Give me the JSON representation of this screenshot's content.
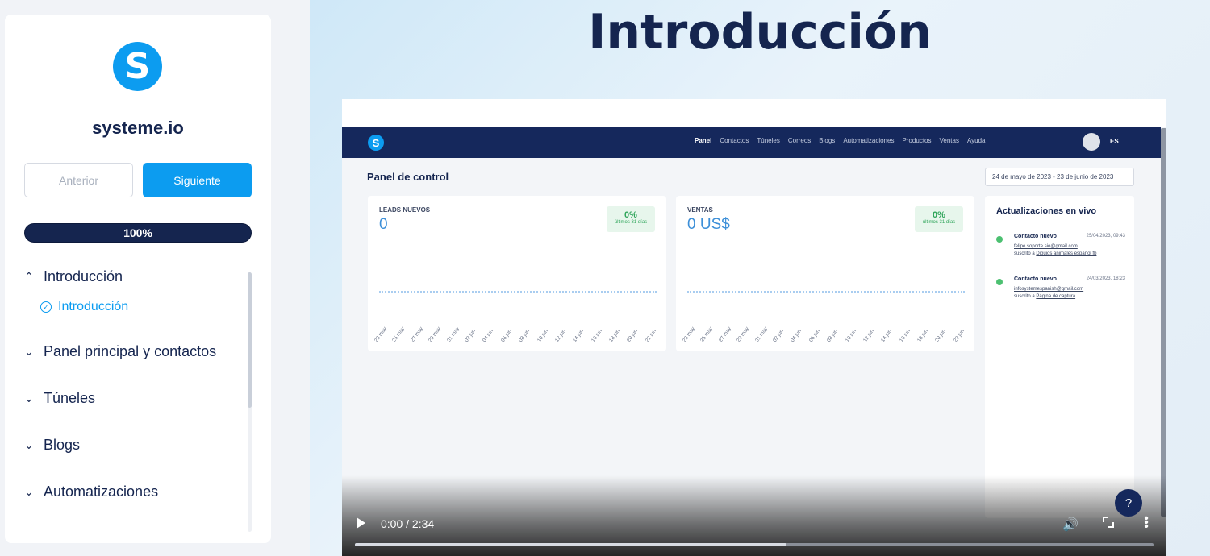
{
  "sidebar": {
    "logo_letter": "S",
    "brand": "systeme.io",
    "prev_label": "Anterior",
    "next_label": "Siguiente",
    "progress_label": "100%",
    "progress_value": 100,
    "sections": [
      {
        "label": "Introducción",
        "expanded": true,
        "lessons": [
          {
            "label": "Introducción",
            "completed": true
          }
        ]
      },
      {
        "label": "Panel principal y contactos",
        "expanded": false
      },
      {
        "label": "Túneles",
        "expanded": false
      },
      {
        "label": "Blogs",
        "expanded": false
      },
      {
        "label": "Automatizaciones",
        "expanded": false
      }
    ]
  },
  "main": {
    "title": "Introducción"
  },
  "video": {
    "logo_letter": "S",
    "menu": [
      "Panel",
      "Contactos",
      "Túneles",
      "Correos",
      "Blogs",
      "Automatizaciones",
      "Productos",
      "Ventas",
      "Ayuda"
    ],
    "lang": "ES",
    "panel_title": "Panel de control",
    "date_range": "24 de mayo de 2023 - 23 de junio de 2023",
    "cards": [
      {
        "label": "LEADS NUEVOS",
        "value": "0",
        "pct": "0%",
        "pct_sub": "últimos 31 días"
      },
      {
        "label": "VENTAS",
        "value": "0 US$",
        "pct": "0%",
        "pct_sub": "últimos 31 días"
      }
    ],
    "ticks": [
      "23 may",
      "25 may",
      "27 may",
      "29 may",
      "31 may",
      "02 jun",
      "04 jun",
      "06 jun",
      "08 jun",
      "10 jun",
      "12 jun",
      "14 jun",
      "16 jun",
      "18 jun",
      "20 jun",
      "22 jun"
    ],
    "live_title": "Actualizaciones en vivo",
    "live_items": [
      {
        "title": "Contacto nuevo",
        "date": "25/04/2023, 09:43",
        "email": "felipe.soporte.sio@gmail.com",
        "sub_prefix": "suscrito a",
        "sub_link": "Dibujos animales español fb"
      },
      {
        "title": "Contacto nuevo",
        "date": "24/03/2023, 18:23",
        "email": "infosystemespanish@gmail.com",
        "sub_prefix": "suscrito a",
        "sub_link": "Página de captura"
      }
    ],
    "help": "?",
    "time": "0:00 / 2:34",
    "progress_fraction": 0.54
  }
}
